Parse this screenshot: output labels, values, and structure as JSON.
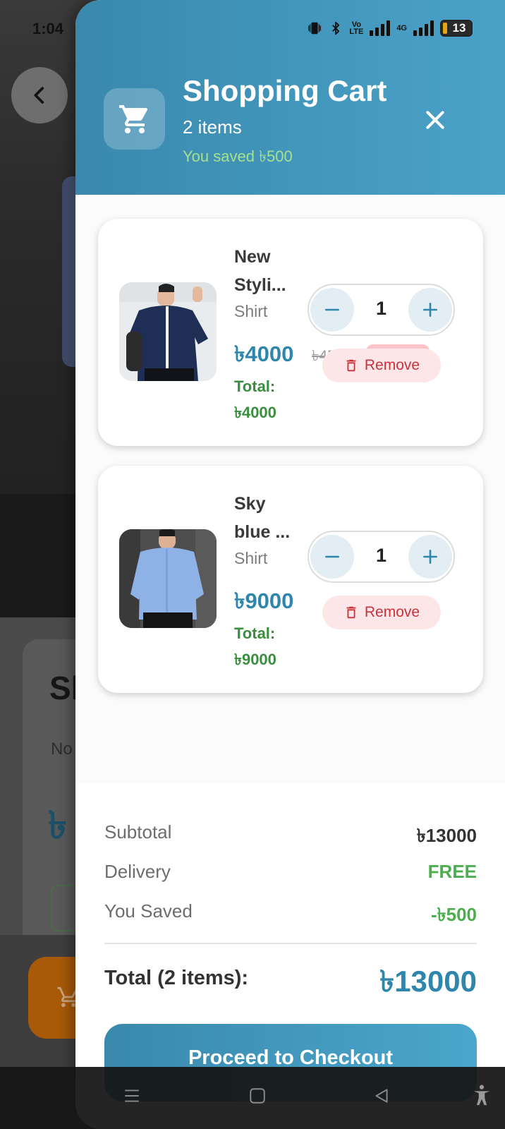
{
  "status_bar": {
    "time": "1:04",
    "network_badge_top": "Vo",
    "network_badge_bottom": "LTE",
    "network_type": "4G",
    "battery_level": "13"
  },
  "drawer": {
    "title": "Shopping Cart",
    "item_count": "2 items",
    "saved_text": "You saved ৳500",
    "accent_color": "#3a89ad"
  },
  "cart_items": [
    {
      "name": "New Styli...",
      "category": "Shirt",
      "price": "৳4000",
      "old_price": "৳4500",
      "total_label": "Total:",
      "total_value": "৳4000",
      "quantity": "1",
      "remove_label": "Remove"
    },
    {
      "name": "Sky blue ...",
      "category": "Shirt",
      "price": "৳9000",
      "total_label": "Total:",
      "total_value": "৳9000",
      "quantity": "1",
      "remove_label": "Remove"
    }
  ],
  "summary": {
    "subtotal_label": "Subtotal",
    "subtotal_value": "৳13000",
    "delivery_label": "Delivery",
    "delivery_value": "FREE",
    "saved_label": "You Saved",
    "saved_value": "-৳500",
    "total_label": "Total (2 items):",
    "total_value": "৳13000",
    "checkout_label": "Proceed to Checkout"
  },
  "background_app": {
    "title_fragment": "Sl",
    "note_fragment": "No",
    "price_fragment": "৳"
  },
  "colors": {
    "primary": "#3a89ad",
    "success": "#3a8f3e",
    "danger": "#c9323b",
    "saved_text": "#a6e08f"
  }
}
